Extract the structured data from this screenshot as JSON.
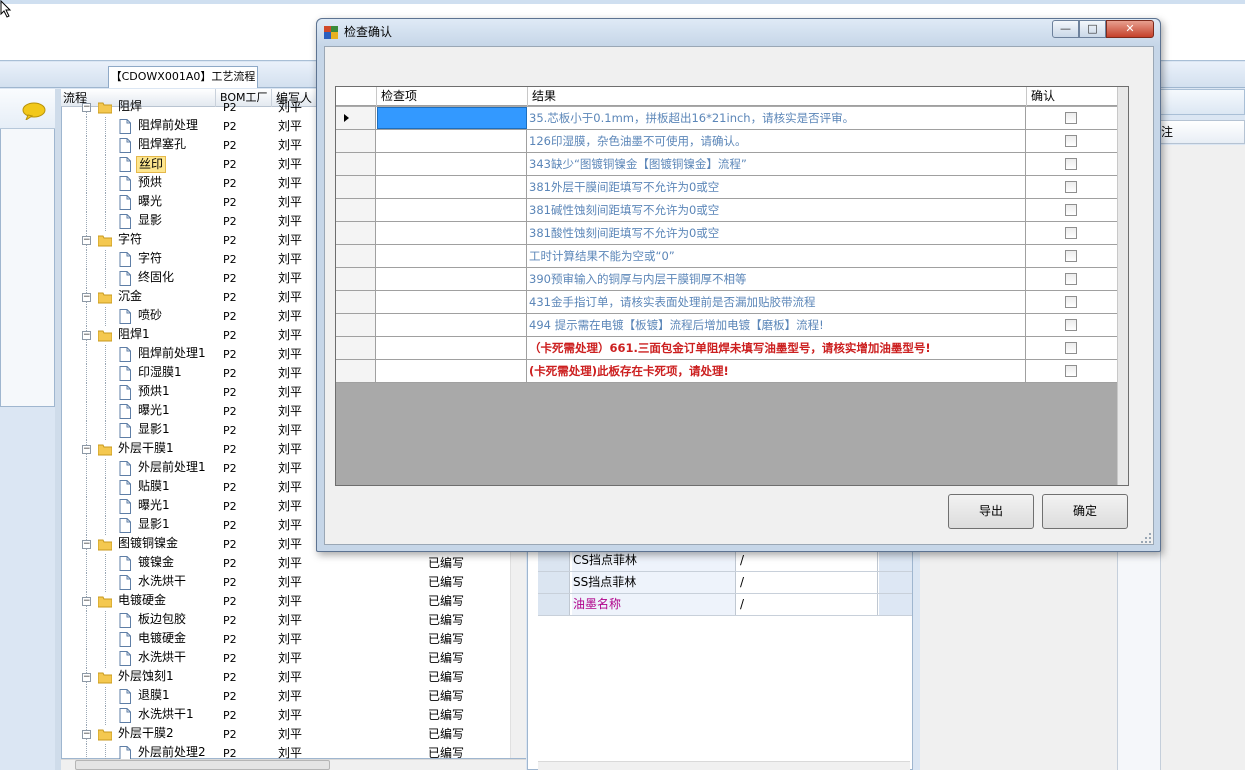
{
  "app": {
    "tab_label": "【CDOWX001A0】工艺流程",
    "tree": {
      "headers": {
        "flow": "流程",
        "bom": "BOM工厂",
        "writer": "编写人"
      },
      "rows": [
        {
          "label": "阻焊",
          "level": 1,
          "type": "folder",
          "bom": "P2",
          "writer": "刘平",
          "status": ""
        },
        {
          "label": "阻焊前处理",
          "level": 2,
          "type": "doc",
          "bom": "P2",
          "writer": "刘平",
          "status": ""
        },
        {
          "label": "阻焊塞孔",
          "level": 2,
          "type": "doc",
          "bom": "P2",
          "writer": "刘平",
          "status": ""
        },
        {
          "label": "丝印",
          "level": 2,
          "type": "doc",
          "bom": "P2",
          "writer": "刘平",
          "status": "",
          "selected": true
        },
        {
          "label": "预烘",
          "level": 2,
          "type": "doc",
          "bom": "P2",
          "writer": "刘平",
          "status": ""
        },
        {
          "label": "曝光",
          "level": 2,
          "type": "doc",
          "bom": "P2",
          "writer": "刘平",
          "status": ""
        },
        {
          "label": "显影",
          "level": 2,
          "type": "doc",
          "bom": "P2",
          "writer": "刘平",
          "status": ""
        },
        {
          "label": "字符",
          "level": 1,
          "type": "folder",
          "bom": "P2",
          "writer": "刘平",
          "status": ""
        },
        {
          "label": "字符",
          "level": 2,
          "type": "doc",
          "bom": "P2",
          "writer": "刘平",
          "status": ""
        },
        {
          "label": "终固化",
          "level": 2,
          "type": "doc",
          "bom": "P2",
          "writer": "刘平",
          "status": ""
        },
        {
          "label": "沉金",
          "level": 1,
          "type": "folder",
          "bom": "P2",
          "writer": "刘平",
          "status": ""
        },
        {
          "label": "喷砂",
          "level": 2,
          "type": "doc",
          "bom": "P2",
          "writer": "刘平",
          "status": ""
        },
        {
          "label": "阻焊1",
          "level": 1,
          "type": "folder",
          "bom": "P2",
          "writer": "刘平",
          "status": ""
        },
        {
          "label": "阻焊前处理1",
          "level": 2,
          "type": "doc",
          "bom": "P2",
          "writer": "刘平",
          "status": ""
        },
        {
          "label": "印湿膜1",
          "level": 2,
          "type": "doc",
          "bom": "P2",
          "writer": "刘平",
          "status": ""
        },
        {
          "label": "预烘1",
          "level": 2,
          "type": "doc",
          "bom": "P2",
          "writer": "刘平",
          "status": ""
        },
        {
          "label": "曝光1",
          "level": 2,
          "type": "doc",
          "bom": "P2",
          "writer": "刘平",
          "status": ""
        },
        {
          "label": "显影1",
          "level": 2,
          "type": "doc",
          "bom": "P2",
          "writer": "刘平",
          "status": ""
        },
        {
          "label": "外层干膜1",
          "level": 1,
          "type": "folder",
          "bom": "P2",
          "writer": "刘平",
          "status": ""
        },
        {
          "label": "外层前处理1",
          "level": 2,
          "type": "doc",
          "bom": "P2",
          "writer": "刘平",
          "status": ""
        },
        {
          "label": "贴膜1",
          "level": 2,
          "type": "doc",
          "bom": "P2",
          "writer": "刘平",
          "status": ""
        },
        {
          "label": "曝光1",
          "level": 2,
          "type": "doc",
          "bom": "P2",
          "writer": "刘平",
          "status": ""
        },
        {
          "label": "显影1",
          "level": 2,
          "type": "doc",
          "bom": "P2",
          "writer": "刘平",
          "status": ""
        },
        {
          "label": "图镀铜镍金",
          "level": 1,
          "type": "folder",
          "bom": "P2",
          "writer": "刘平",
          "status": "已编写"
        },
        {
          "label": "镀镍金",
          "level": 2,
          "type": "doc",
          "bom": "P2",
          "writer": "刘平",
          "status": "已编写"
        },
        {
          "label": "水洗烘干",
          "level": 2,
          "type": "doc",
          "bom": "P2",
          "writer": "刘平",
          "status": "已编写"
        },
        {
          "label": "电镀硬金",
          "level": 1,
          "type": "folder",
          "bom": "P2",
          "writer": "刘平",
          "status": "已编写"
        },
        {
          "label": "板边包胶",
          "level": 2,
          "type": "doc",
          "bom": "P2",
          "writer": "刘平",
          "status": "已编写"
        },
        {
          "label": "电镀硬金",
          "level": 2,
          "type": "doc",
          "bom": "P2",
          "writer": "刘平",
          "status": "已编写"
        },
        {
          "label": "水洗烘干",
          "level": 2,
          "type": "doc",
          "bom": "P2",
          "writer": "刘平",
          "status": "已编写"
        },
        {
          "label": "外层蚀刻1",
          "level": 1,
          "type": "folder",
          "bom": "P2",
          "writer": "刘平",
          "status": "已编写"
        },
        {
          "label": "退膜1",
          "level": 2,
          "type": "doc",
          "bom": "P2",
          "writer": "刘平",
          "status": "已编写"
        },
        {
          "label": "水洗烘干1",
          "level": 2,
          "type": "doc",
          "bom": "P2",
          "writer": "刘平",
          "status": "已编写"
        },
        {
          "label": "外层干膜2",
          "level": 1,
          "type": "folder",
          "bom": "P2",
          "writer": "刘平",
          "status": "已编写"
        },
        {
          "label": "外层前处理2",
          "level": 2,
          "type": "doc",
          "bom": "P2",
          "writer": "刘平",
          "status": "已编写"
        }
      ]
    },
    "mid_params": [
      {
        "name": "CS挡点菲林",
        "value": "/",
        "magenta": false
      },
      {
        "name": "SS挡点菲林",
        "value": "/",
        "magenta": false
      },
      {
        "name": "油墨名称",
        "value": "/",
        "magenta": true
      }
    ],
    "right_header_fragment": "注"
  },
  "dialog": {
    "title": "检查确认",
    "caption_buttons": {
      "minimize": "—",
      "maximize": "□",
      "close": "✕"
    },
    "grid": {
      "headers": {
        "item": "检查项",
        "result": "结果",
        "confirm": "确认"
      },
      "rows": [
        {
          "item": "",
          "result": "35.芯板小于0.1mm，拼板超出16*21inch，请核实是否评审。",
          "red": false,
          "checked": false,
          "current": true
        },
        {
          "item": "",
          "result": "126印湿膜，杂色油墨不可使用，请确认。",
          "red": false,
          "checked": false
        },
        {
          "item": "",
          "result": "343缺少“图镀铜镍金【图镀铜镍金】流程”",
          "red": false,
          "checked": false
        },
        {
          "item": "",
          "result": "381外层干膜间距填写不允许为0或空",
          "red": false,
          "checked": false
        },
        {
          "item": "",
          "result": "381碱性蚀刻间距填写不允许为0或空",
          "red": false,
          "checked": false
        },
        {
          "item": "",
          "result": "381酸性蚀刻间距填写不允许为0或空",
          "red": false,
          "checked": false
        },
        {
          "item": "",
          "result": "工时计算结果不能为空或“0”",
          "red": false,
          "checked": false
        },
        {
          "item": "",
          "result": "390预审输入的铜厚与内层干膜铜厚不相等",
          "red": false,
          "checked": false
        },
        {
          "item": "",
          "result": "431金手指订单，请核实表面处理前是否漏加贴胶带流程",
          "red": false,
          "checked": false
        },
        {
          "item": "",
          "result": "494 提示需在电镀【板镀】流程后增加电镀【磨板】流程!",
          "red": false,
          "checked": false
        },
        {
          "item": "",
          "result": "（卡死需处理）661.三面包金订单阻焊未填写油墨型号，请核实增加油墨型号!",
          "red": true,
          "checked": false
        },
        {
          "item": "",
          "result": "(卡死需处理)此板存在卡死项，请处理!",
          "red": true,
          "checked": false
        }
      ]
    },
    "buttons": {
      "export": "导出",
      "ok": "确定"
    }
  },
  "colors": {
    "result_text": "#5b86b8",
    "result_red": "#cc1f1f",
    "selection_blue": "#3399ff",
    "tree_selected": "#fde68e",
    "param_magenta": "#b0008a"
  }
}
